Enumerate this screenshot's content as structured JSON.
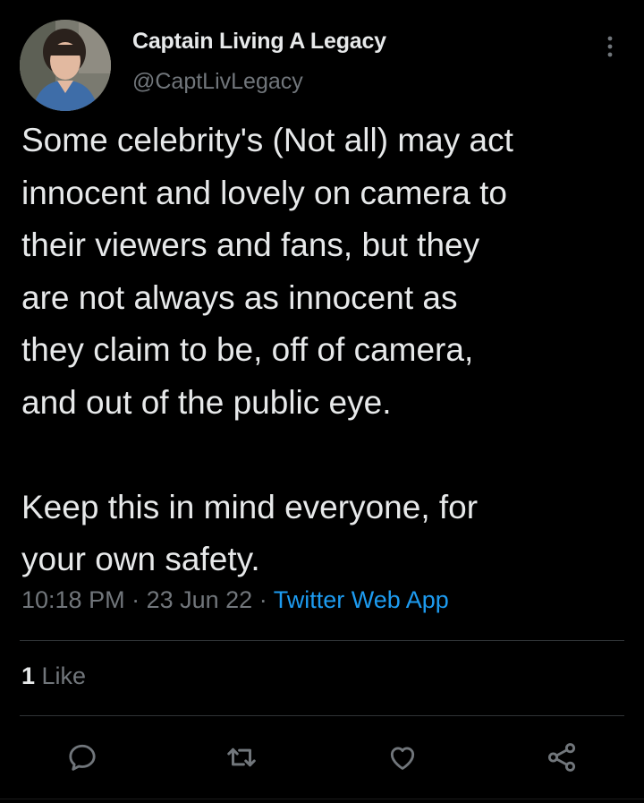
{
  "author": {
    "display_name": "Captain Living A Legacy",
    "handle": "@CaptLivLegacy",
    "avatar_icon": "profile-photo"
  },
  "tweet": {
    "paragraph1_lines": [
      "Some celebrity's (Not all) may act",
      "innocent and lovely on camera to",
      "their viewers and fans, but they",
      "are not always as innocent as",
      "they claim to be, off of camera,",
      "and out of the public eye."
    ],
    "paragraph2_lines": [
      "Keep this in mind everyone, for",
      "your own safety."
    ]
  },
  "meta": {
    "time": "10:18 PM",
    "separator": " · ",
    "date": "23 Jun 22",
    "source": "Twitter Web App"
  },
  "engagement": {
    "like_count": "1",
    "like_label": " Like"
  },
  "actions": {
    "reply_icon": "speech-bubble-icon",
    "retweet_icon": "retweet-arrows-icon",
    "like_icon": "heart-icon",
    "share_icon": "share-nodes-icon",
    "more_icon": "vertical-ellipsis-icon"
  },
  "colors": {
    "background": "#000000",
    "text": "#e7e9ea",
    "secondary_text": "#71767b",
    "link": "#1d9bf0",
    "divider": "#2f3336"
  }
}
